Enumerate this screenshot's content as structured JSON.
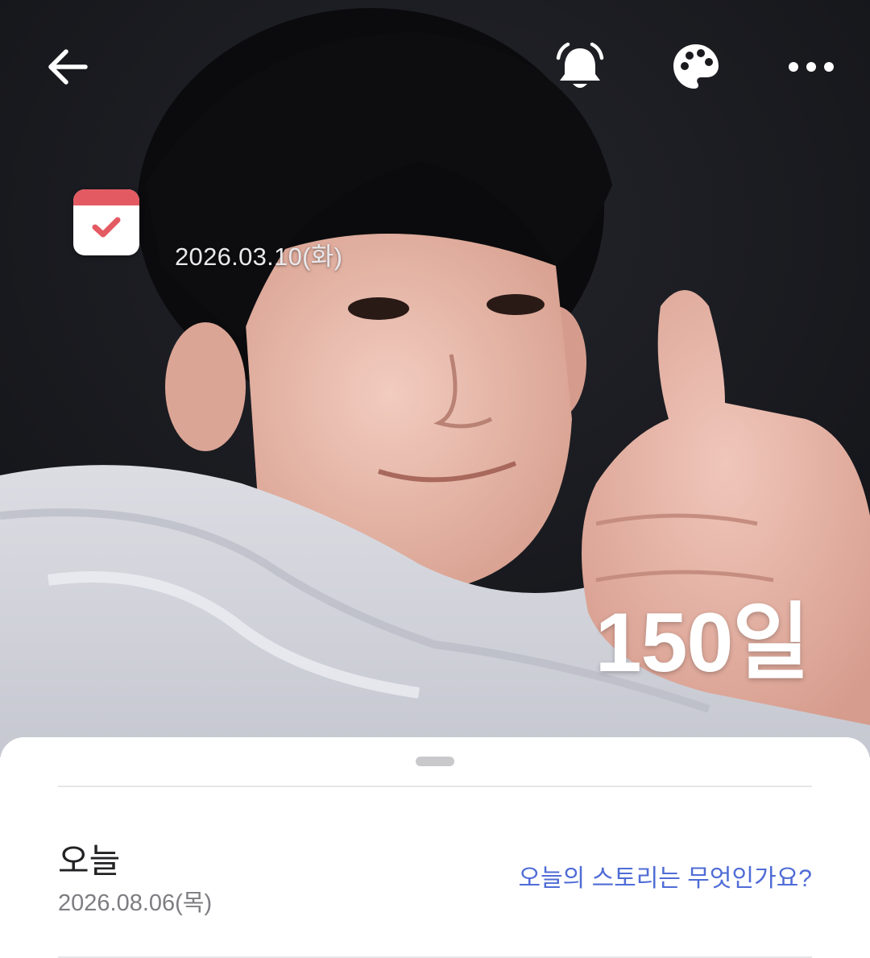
{
  "header": {
    "back_icon": "arrow-left-icon",
    "alarm_icon": "alarm-bell-icon",
    "theme_icon": "palette-icon",
    "more_icon": "more-dots-icon"
  },
  "hero": {
    "calendar_icon": "calendar-check-icon",
    "start_date": "2026.03.10(화)",
    "day_count": "150일"
  },
  "today": {
    "title": "오늘",
    "date": "2026.08.06(목)",
    "story_prompt": "오늘의 스토리는 무엇인가요?"
  },
  "colors": {
    "accent_link": "#4f6cd6",
    "calendar_red": "#e45a62"
  }
}
